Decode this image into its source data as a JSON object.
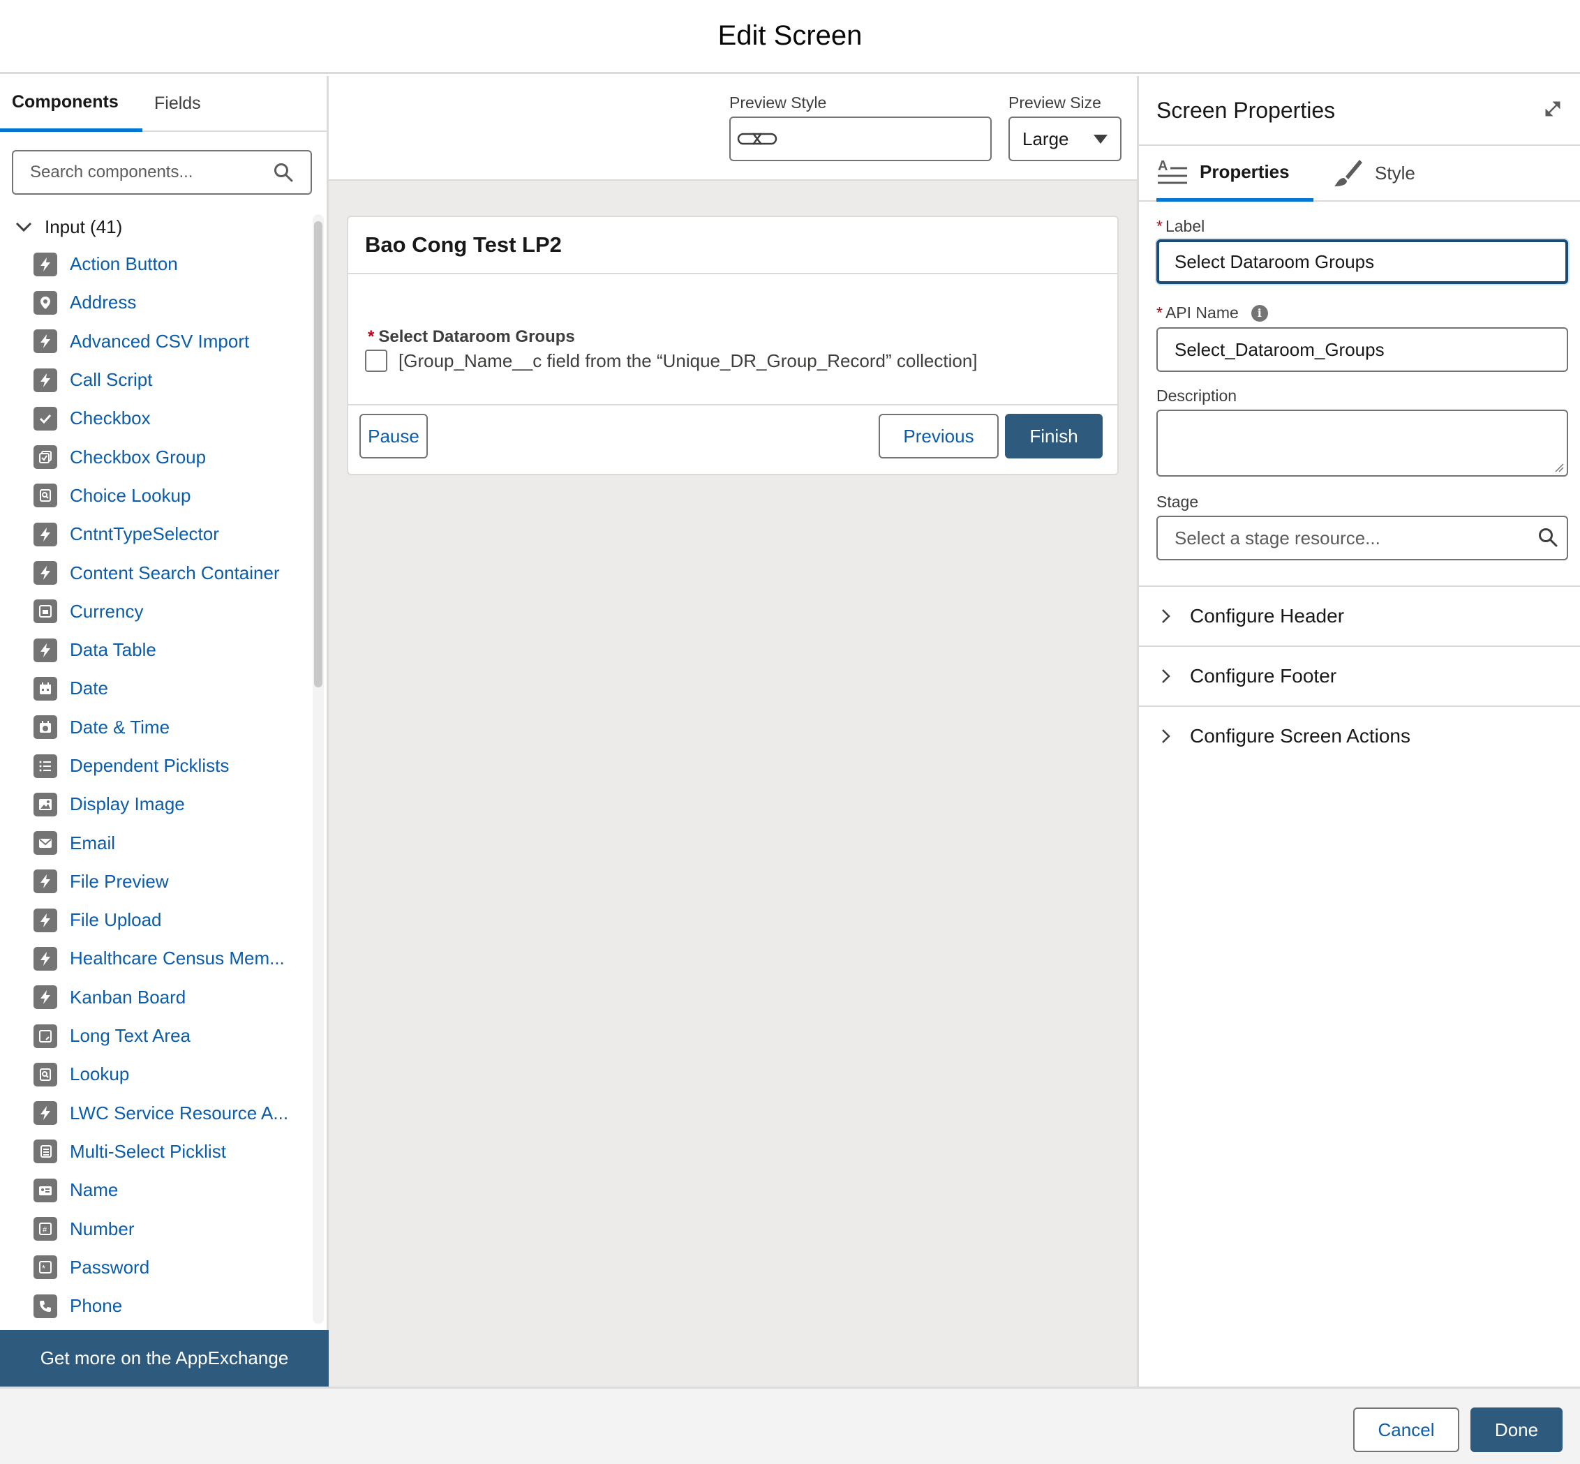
{
  "modal": {
    "title": "Edit Screen"
  },
  "left_panel": {
    "tabs": [
      {
        "label": "Components",
        "active": true
      },
      {
        "label": "Fields",
        "active": false
      }
    ],
    "search_placeholder": "Search components...",
    "group": {
      "label": "Input (41)",
      "expanded": true
    },
    "items": [
      {
        "label": "Action Button",
        "icon": "bolt-icon"
      },
      {
        "label": "Address",
        "icon": "location-pin-icon"
      },
      {
        "label": "Advanced CSV Import",
        "icon": "bolt-icon"
      },
      {
        "label": "Call Script",
        "icon": "bolt-icon"
      },
      {
        "label": "Checkbox",
        "icon": "check-icon"
      },
      {
        "label": "Checkbox Group",
        "icon": "checkbox-group-icon"
      },
      {
        "label": "Choice Lookup",
        "icon": "choice-lookup-icon"
      },
      {
        "label": "CntntTypeSelector",
        "icon": "bolt-icon"
      },
      {
        "label": "Content Search Container",
        "icon": "bolt-icon"
      },
      {
        "label": "Currency",
        "icon": "currency-icon"
      },
      {
        "label": "Data Table",
        "icon": "bolt-icon"
      },
      {
        "label": "Date",
        "icon": "calendar-icon"
      },
      {
        "label": "Date & Time",
        "icon": "calendar-clock-icon"
      },
      {
        "label": "Dependent Picklists",
        "icon": "list-icon"
      },
      {
        "label": "Display Image",
        "icon": "image-icon"
      },
      {
        "label": "Email",
        "icon": "email-icon"
      },
      {
        "label": "File Preview",
        "icon": "bolt-icon"
      },
      {
        "label": "File Upload",
        "icon": "bolt-icon"
      },
      {
        "label": "Healthcare Census Mem...",
        "icon": "bolt-icon"
      },
      {
        "label": "Kanban Board",
        "icon": "bolt-icon"
      },
      {
        "label": "Long Text Area",
        "icon": "textarea-icon"
      },
      {
        "label": "Lookup",
        "icon": "lookup-icon"
      },
      {
        "label": "LWC Service Resource A...",
        "icon": "bolt-icon"
      },
      {
        "label": "Multi-Select Picklist",
        "icon": "multi-picklist-icon"
      },
      {
        "label": "Name",
        "icon": "name-card-icon"
      },
      {
        "label": "Number",
        "icon": "number-icon"
      },
      {
        "label": "Password",
        "icon": "password-icon"
      },
      {
        "label": "Phone",
        "icon": "phone-icon"
      }
    ],
    "appexchange_label": "Get more on the AppExchange"
  },
  "preview": {
    "style_label": "Preview Style",
    "size_label": "Preview Size",
    "size_value": "Large",
    "card_title": "Bao Cong Test LP2",
    "field_required_mark": "*",
    "field_label": "Select Dataroom Groups",
    "checkbox_text": "[Group_Name__c field from the “Unique_DR_Group_Record” collection]",
    "buttons": {
      "pause": "Pause",
      "previous": "Previous",
      "finish": "Finish"
    }
  },
  "properties": {
    "title": "Screen Properties",
    "tabs": [
      {
        "label": "Properties",
        "active": true
      },
      {
        "label": "Style",
        "active": false
      }
    ],
    "required_mark": "*",
    "label_label": "Label",
    "label_value": "Select Dataroom Groups",
    "api_label": "API Name",
    "api_value": "Select_Dataroom_Groups",
    "description_label": "Description",
    "stage_label": "Stage",
    "stage_placeholder": "Select a stage resource...",
    "sections": [
      "Configure Header",
      "Configure Footer",
      "Configure Screen Actions"
    ]
  },
  "footer": {
    "cancel": "Cancel",
    "done": "Done"
  },
  "colors": {
    "brand": "#2e5a7e",
    "link": "#0b5cab",
    "tab_active": "#0176d3",
    "required": "#ba0517"
  }
}
